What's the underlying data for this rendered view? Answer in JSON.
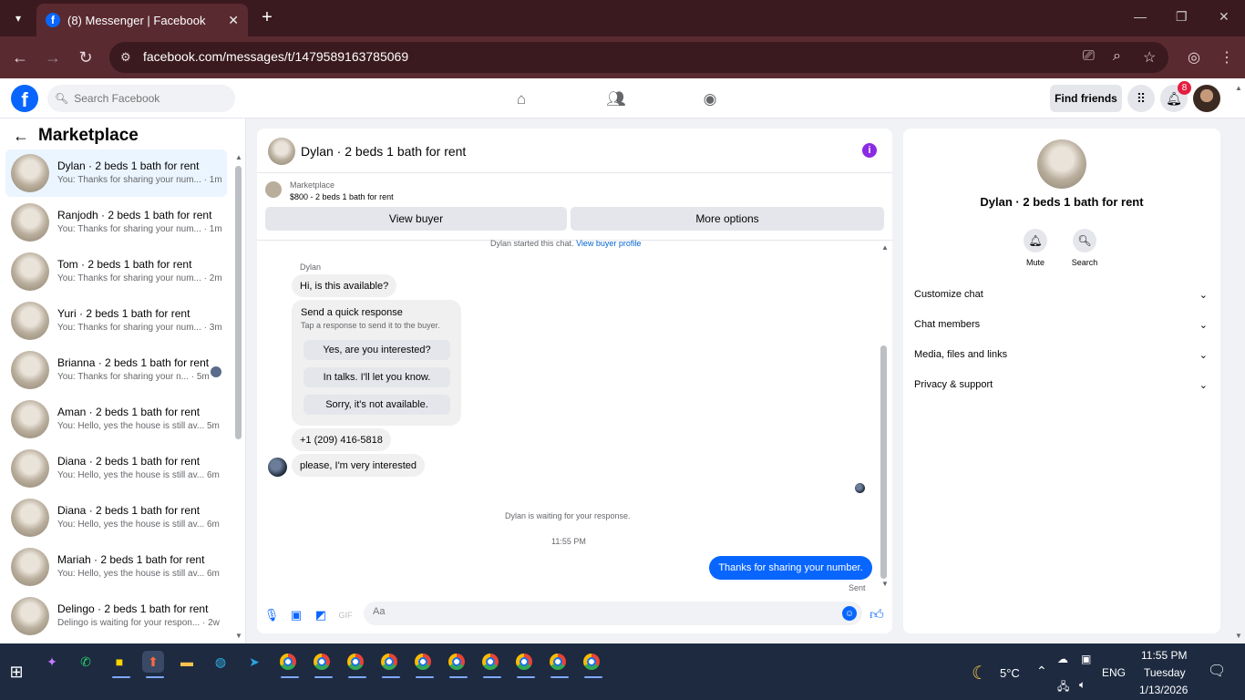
{
  "browser": {
    "tab_title": "(8) Messenger | Facebook",
    "url": "facebook.com/messages/t/1479589163785069"
  },
  "header": {
    "search_placeholder": "Search Facebook",
    "find_friends": "Find friends",
    "notification_count": "8"
  },
  "sidebar": {
    "title": "Marketplace",
    "conversations": [
      {
        "name": "Dylan · 2 beds 1 bath for rent",
        "preview": "You: Thanks for sharing your num... · 1m",
        "active": true
      },
      {
        "name": "Ranjodh · 2 beds 1 bath for rent",
        "preview": "You: Thanks for sharing your num... · 1m"
      },
      {
        "name": "Tom · 2 beds 1 bath for rent",
        "preview": "You: Thanks for sharing your num... · 2m"
      },
      {
        "name": "Yuri · 2 beds 1 bath for rent",
        "preview": "You: Thanks for sharing your num... · 3m"
      },
      {
        "name": "Brianna · 2 beds 1 bath for rent",
        "preview": "You: Thanks for sharing your n... · 5m"
      },
      {
        "name": "Aman · 2 beds 1 bath for rent",
        "preview": "You: Hello, yes the house is still av... 5m"
      },
      {
        "name": "Diana · 2 beds 1 bath for rent",
        "preview": "You: Hello, yes the house is still av... 6m"
      },
      {
        "name": "Diana · 2 beds 1 bath for rent",
        "preview": "You: Hello, yes the house is still av... 6m"
      },
      {
        "name": "Mariah · 2 beds 1 bath for rent",
        "preview": "You: Hello, yes the house is still av... 6m"
      },
      {
        "name": "Delingo · 2 beds 1 bath for rent",
        "preview": "Delingo is waiting for your respon... · 2w"
      }
    ]
  },
  "chat": {
    "title": "Dylan · 2 beds 1 bath for rent",
    "marketplace_label": "Marketplace",
    "listing": "$800 - 2 beds 1 bath for rent",
    "view_buyer": "View buyer",
    "more_options": "More options",
    "started_text": "Dylan started this chat.",
    "buyer_profile_link": "View buyer profile",
    "sender_name": "Dylan",
    "msg1": "Hi, is this available?",
    "quick_title": "Send a quick response",
    "quick_sub": "Tap a response to send it to the buyer.",
    "quick_options": [
      "Yes, are you interested?",
      "In talks. I'll let you know.",
      "Sorry, it's not available."
    ],
    "msg_phone": "+1 (209) 416-5818",
    "msg2": "please, I'm very interested",
    "waiting_text": "Dylan is waiting for your response.",
    "time": "11:55 PM",
    "sent_msg": "Thanks for sharing your number.",
    "sent_status": "Sent",
    "composer_placeholder": "Aa"
  },
  "right_panel": {
    "name": "Dylan · 2 beds 1 bath for rent",
    "mute": "Mute",
    "search": "Search",
    "sections": [
      "Customize chat",
      "Chat members",
      "Media, files and links",
      "Privacy & support"
    ]
  },
  "taskbar": {
    "weather": "5°C",
    "lang": "ENG",
    "time": "11:55 PM",
    "day": "Tuesday",
    "date": "1/13/2026"
  }
}
